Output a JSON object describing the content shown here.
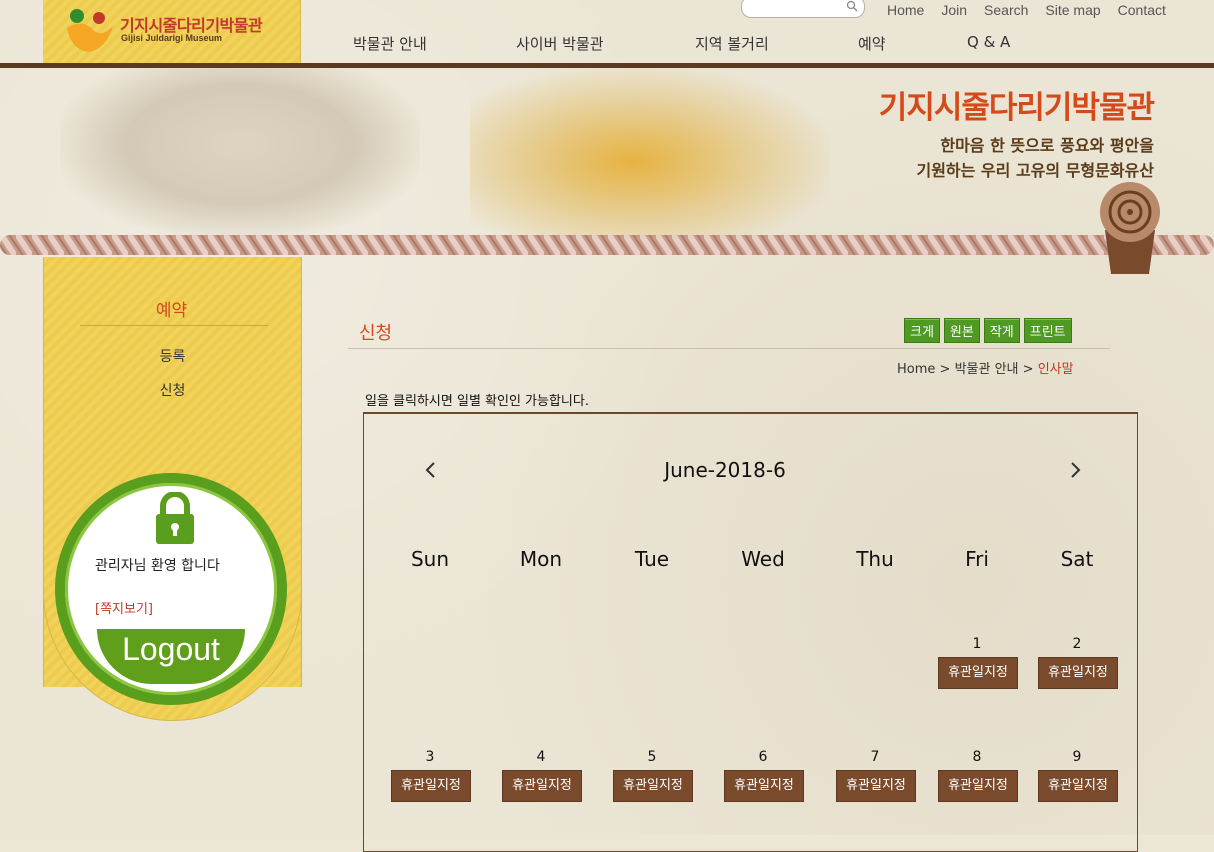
{
  "header": {
    "logo_title": "기지시줄다리기박물관",
    "logo_subtitle": "Gijisi Juldarigi Museum",
    "util_links": [
      "Home",
      "Join",
      "Search",
      "Site map",
      "Contact"
    ],
    "nav": [
      "박물관 안내",
      "사이버 박물관",
      "지역 볼거리",
      "예약",
      "Q & A"
    ]
  },
  "banner": {
    "title": "기지시줄다리기박물관",
    "line1": "한마음 한 뜻으로 풍요와 평안을",
    "line2": "기원하는 우리 고유의 무형문화유산"
  },
  "sidebar": {
    "title": "예약",
    "items": [
      "등록",
      "신청"
    ],
    "welcome": "관리자님 환영 합니다",
    "memo_link": "[쪽지보기]",
    "logout": "Logout"
  },
  "content": {
    "title": "신청",
    "tools": [
      "크게",
      "원본",
      "작게",
      "프린트"
    ],
    "breadcrumb": {
      "home": "Home",
      "section": "박물관 안내",
      "current": "인사말"
    },
    "guide": "일을 클릭하시면 일별 확인인 가능합니다."
  },
  "calendar": {
    "heading": "June-2018-6",
    "weekdays": [
      "Sun",
      "Mon",
      "Tue",
      "Wed",
      "Thu",
      "Fri",
      "Sat"
    ],
    "holiday_label": "휴관일지정",
    "week1": [
      {
        "day": "1",
        "label": "휴관일지정"
      },
      {
        "day": "2",
        "label": "휴관일지정"
      }
    ],
    "week2": [
      {
        "day": "3",
        "label": "휴관일지정"
      },
      {
        "day": "4",
        "label": "휴관일지정"
      },
      {
        "day": "5",
        "label": "휴관일지정"
      },
      {
        "day": "6",
        "label": "휴관일지정"
      },
      {
        "day": "7",
        "label": "휴관일지정"
      },
      {
        "day": "8",
        "label": "휴관일지정"
      },
      {
        "day": "9",
        "label": "휴관일지정"
      }
    ]
  },
  "colors": {
    "accent": "#d44a1a",
    "green": "#5a9e1e",
    "brown": "#7a4a2c",
    "sidebar_yellow": "#f2d35a"
  }
}
